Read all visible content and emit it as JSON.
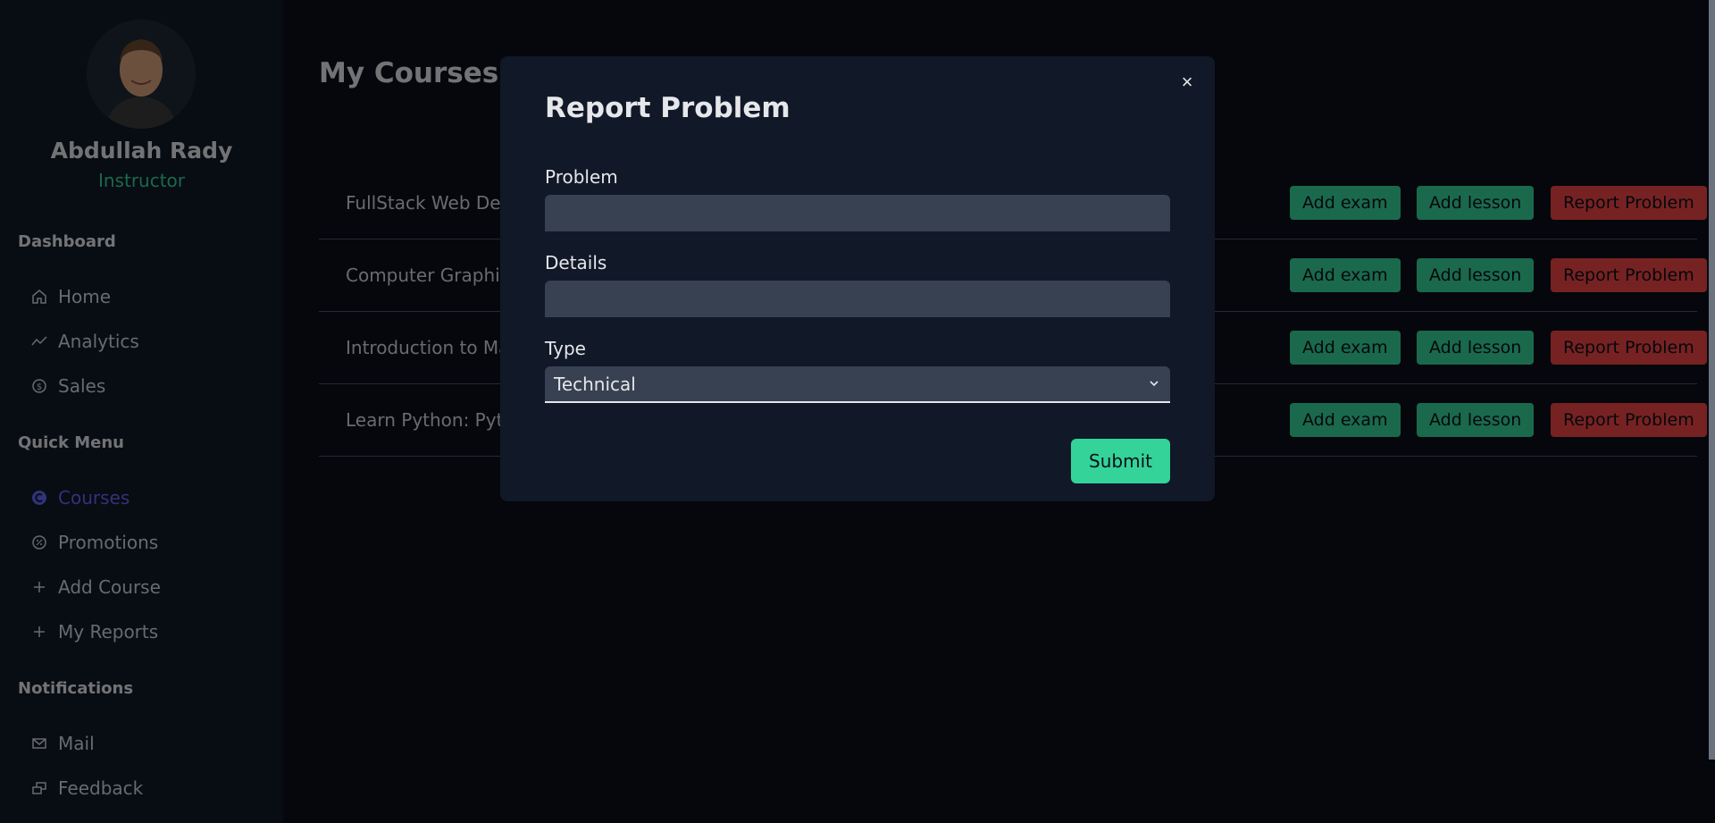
{
  "user": {
    "name": "Abdullah Rady",
    "role": "Instructor"
  },
  "sidebar": {
    "sections": [
      {
        "title": "Dashboard",
        "items": [
          {
            "label": "Home",
            "icon": "home-icon"
          },
          {
            "label": "Analytics",
            "icon": "trend-icon"
          },
          {
            "label": "Sales",
            "icon": "currency-icon"
          }
        ]
      },
      {
        "title": "Quick Menu",
        "items": [
          {
            "label": "Courses",
            "icon": "courses-icon",
            "active": true
          },
          {
            "label": "Promotions",
            "icon": "promotions-icon"
          },
          {
            "label": "Add Course",
            "icon": "plus-icon"
          },
          {
            "label": "My Reports",
            "icon": "plus-icon"
          }
        ]
      },
      {
        "title": "Notifications",
        "items": [
          {
            "label": "Mail",
            "icon": "mail-icon"
          },
          {
            "label": "Feedback",
            "icon": "feedback-icon"
          }
        ]
      }
    ]
  },
  "main": {
    "title": "My Courses",
    "courses": [
      {
        "title": "FullStack Web Dev"
      },
      {
        "title": "Computer Graphi"
      },
      {
        "title": "Introduction to Ma"
      },
      {
        "title": "Learn Python: Pyth"
      }
    ],
    "actions": {
      "add_exam": "Add exam",
      "add_lesson": "Add lesson",
      "report": "Report Problem"
    }
  },
  "modal": {
    "title": "Report Problem",
    "close_label": "×",
    "problem_label": "Problem",
    "problem_value": "",
    "details_label": "Details",
    "details_value": "",
    "type_label": "Type",
    "type_value": "Technical",
    "submit_label": "Submit"
  },
  "colors": {
    "accent_green": "#34d399",
    "danger_red": "#ef4444",
    "active_nav": "#6366f1"
  }
}
